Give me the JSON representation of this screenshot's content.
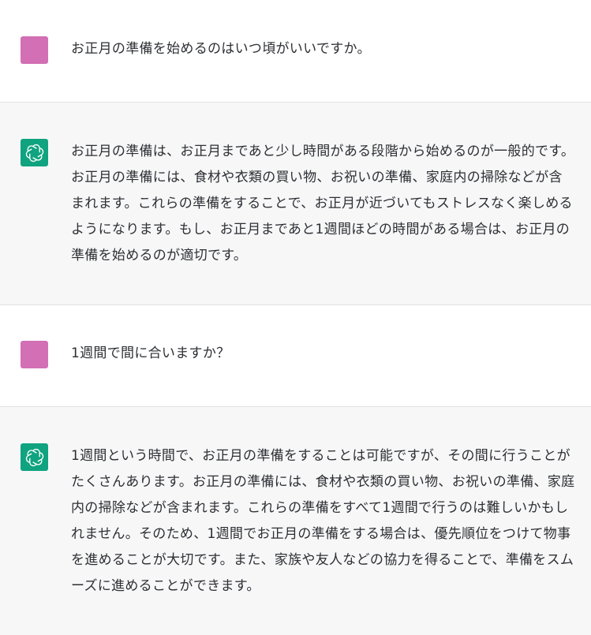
{
  "conversation": {
    "messages": [
      {
        "role": "user",
        "text": "お正月の準備を始めるのはいつ頃がいいですか。"
      },
      {
        "role": "assistant",
        "text": "お正月の準備は、お正月まであと少し時間がある段階から始めるのが一般的です。お正月の準備には、食材や衣類の買い物、お祝いの準備、家庭内の掃除などが含まれます。これらの準備をすることで、お正月が近づいてもストレスなく楽しめるようになります。もし、お正月まであと1週間ほどの時間がある場合は、お正月の準備を始めるのが適切です。"
      },
      {
        "role": "user",
        "text": "1週間で間に合いますか？"
      },
      {
        "role": "assistant",
        "text": "1週間という時間で、お正月の準備をすることは可能ですが、その間に行うことがたくさんあります。お正月の準備には、食材や衣類の買い物、お祝いの準備、家庭内の掃除などが含まれます。これらの準備をすべて1週間で行うのは難しいかもしれません。そのため、1週間でお正月の準備をする場合は、優先順位をつけて物事を進めることが大切です。また、家族や友人などの協力を得ることで、準備をスムーズに進めることができます。"
      }
    ]
  },
  "colors": {
    "user_avatar": "#d36fb5",
    "assistant_avatar": "#10a37f",
    "assistant_background": "#f7f7f8"
  },
  "icons": {
    "user_avatar": "user-avatar",
    "assistant_avatar": "openai-logo-icon"
  }
}
